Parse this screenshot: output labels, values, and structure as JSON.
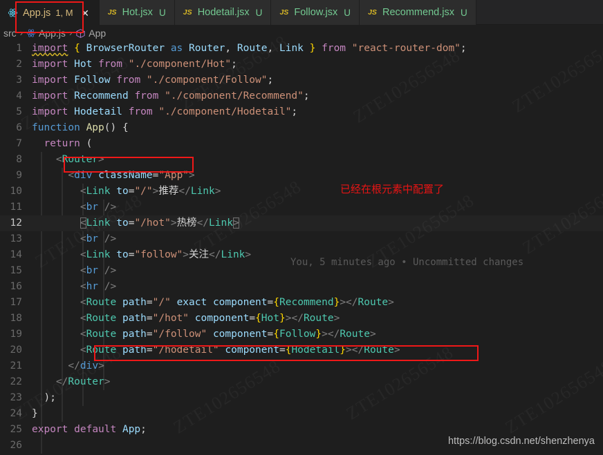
{
  "window": {
    "theme_bg": "#1e1e1e",
    "accent_red": "#f01818"
  },
  "tabs": [
    {
      "icon": "react-icon",
      "label": "App.js",
      "badge": "1, M",
      "status": "",
      "active": true,
      "closable": true
    },
    {
      "icon": "js-icon",
      "label": "Hot.jsx",
      "badge": "",
      "status": "U",
      "active": false,
      "closable": false
    },
    {
      "icon": "js-icon",
      "label": "Hodetail.jsx",
      "badge": "",
      "status": "U",
      "active": false,
      "closable": false
    },
    {
      "icon": "js-icon",
      "label": "Follow.jsx",
      "badge": "",
      "status": "U",
      "active": false,
      "closable": false
    },
    {
      "icon": "js-icon",
      "label": "Recommend.jsx",
      "badge": "",
      "status": "U",
      "active": false,
      "closable": false
    }
  ],
  "close_glyph": "✕",
  "breadcrumb": {
    "separator": "›",
    "items": [
      {
        "label": "src",
        "icon": ""
      },
      {
        "label": "App.js",
        "icon": "react-icon"
      },
      {
        "label": "App",
        "icon": "cube-icon"
      }
    ]
  },
  "editor": {
    "active_line": 12,
    "line_numbers": [
      1,
      2,
      3,
      4,
      5,
      6,
      7,
      8,
      9,
      10,
      11,
      12,
      13,
      14,
      15,
      16,
      17,
      18,
      19,
      20,
      21,
      22,
      23,
      24,
      25,
      26
    ],
    "lines": [
      "import { BrowserRouter as Router, Route, Link } from \"react-router-dom\";",
      "import Hot from \"./component/Hot\";",
      "import Follow from \"./component/Follow\";",
      "import Recommend from \"./component/Recommend\";",
      "import Hodetail from \"./component/Hodetail\";",
      "function App() {",
      "  return (",
      "    <Router>",
      "      <div className=\"App\">",
      "        <Link to=\"/\">推荐</Link>",
      "        <br />",
      "        <Link to=\"/hot\">热榜</Link>",
      "        <br />",
      "        <Link to=\"follow\">关注</Link>",
      "        <br />",
      "        <hr />",
      "        <Route path=\"/\" exact component={Recommend}></Route>",
      "        <Route path=\"/hot\" component={Hot}></Route>",
      "        <Route path=\"/follow\" component={Follow}></Route>",
      "        <Route path=\"/hodetail\" component={Hodetail}></Route>",
      "      </div>",
      "    </Router>",
      "  );",
      "}",
      "export default App;",
      ""
    ]
  },
  "annotations": {
    "note_text": "已经在根元素中配置了",
    "blame_text": "You, 5 minutes ago • Uncommitted changes",
    "source_url": "https://blog.csdn.net/shenzhenya",
    "highlight_boxes": [
      {
        "name": "tab-highlight-box"
      },
      {
        "name": "router-line-box"
      },
      {
        "name": "hodetail-route-box"
      }
    ]
  },
  "watermark": {
    "text": "ZTE102656548"
  }
}
